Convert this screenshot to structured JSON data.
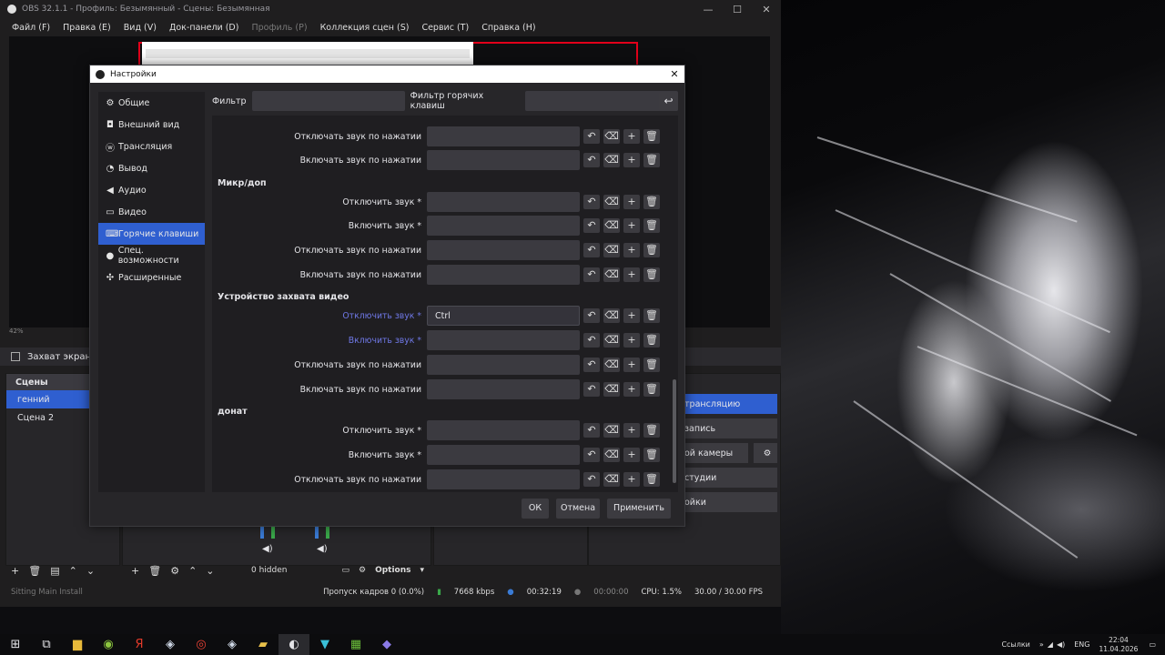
{
  "app": {
    "window_title": "OBS 32.1.1 - Профиль: Безымянный - Сцены: Безымянная",
    "menu": [
      "Файл (F)",
      "Правка (E)",
      "Вид (V)",
      "Док-панели (D)",
      "Профиль (P)",
      "Коллекция сцен (S)",
      "Сервис (T)",
      "Справка (H)"
    ],
    "zoom": "42%",
    "source_item": "Захват экрана",
    "scenes_title": "Сцены",
    "scenes": [
      "генний",
      "Сцена 2"
    ],
    "controls": [
      "трансляцию",
      "запись",
      "ой камеры",
      "студии",
      "ойки"
    ],
    "hidden_count": "0 hidden",
    "options_label": "Options",
    "status": {
      "cut_text": "Sitting    Main Install",
      "dropped": "Пропуск кадров 0 (0.0%)",
      "bitrate": "7668 kbps",
      "stream_time": "00:32:19",
      "rec_time": "00:00:00",
      "cpu": "CPU: 1.5%",
      "fps": "30.00 / 30.00 FPS"
    }
  },
  "dialog": {
    "title": "Настройки",
    "nav": [
      {
        "label": "Общие",
        "icon": "gear-icon",
        "glyph": "⚙"
      },
      {
        "label": "Внешний вид",
        "icon": "palette-icon",
        "glyph": "◘"
      },
      {
        "label": "Трансляция",
        "icon": "broadcast-icon",
        "glyph": "ⓦ"
      },
      {
        "label": "Вывод",
        "icon": "output-icon",
        "glyph": "◔"
      },
      {
        "label": "Аудио",
        "icon": "speaker-icon",
        "glyph": "◀"
      },
      {
        "label": "Видео",
        "icon": "monitor-icon",
        "glyph": "▭"
      },
      {
        "label": "Горячие клавиши",
        "icon": "keyboard-icon",
        "glyph": "⌨"
      },
      {
        "label": "Спец. возможности",
        "icon": "accessibility-icon",
        "glyph": "●"
      },
      {
        "label": "Расширенные",
        "icon": "wrench-icon",
        "glyph": "✣"
      }
    ],
    "selected_nav": 6,
    "filter_label": "Фильтр",
    "filter_value": "",
    "hotkey_filter_label": "Фильтр горячих клавиш",
    "hotkey_filter_value": "",
    "rows": {
      "r1": "Отключать звук по нажатии",
      "r2": "Включать звук по нажатии",
      "g1": "Микр/доп",
      "r3": "Отключить звук *",
      "r4": "Включить звук *",
      "r5": "Отключать звук по нажатии",
      "r6": "Включать звук по нажатии",
      "g2": "Устройство захвата видео",
      "r7": "Отключить звук *",
      "r7_value": "Ctrl",
      "r8": "Включить звук *",
      "r9": "Отключать звук по нажатии",
      "r10": "Включать звук по нажатии",
      "g3": "донат",
      "r11": "Отключить звук *",
      "r12": "Включить звук *",
      "r13": "Отключать звук по нажатии"
    },
    "buttons": {
      "ok": "ОК",
      "cancel": "Отмена",
      "apply": "Применить"
    }
  },
  "taskbar": {
    "links": "Ссылки",
    "lang": "ENG",
    "time": "22:04",
    "date": "11.04.2026"
  },
  "colors": {
    "accent": "#2f5fd0",
    "highlight_text": "#6f78e6",
    "preview_border": "#e2001a"
  }
}
